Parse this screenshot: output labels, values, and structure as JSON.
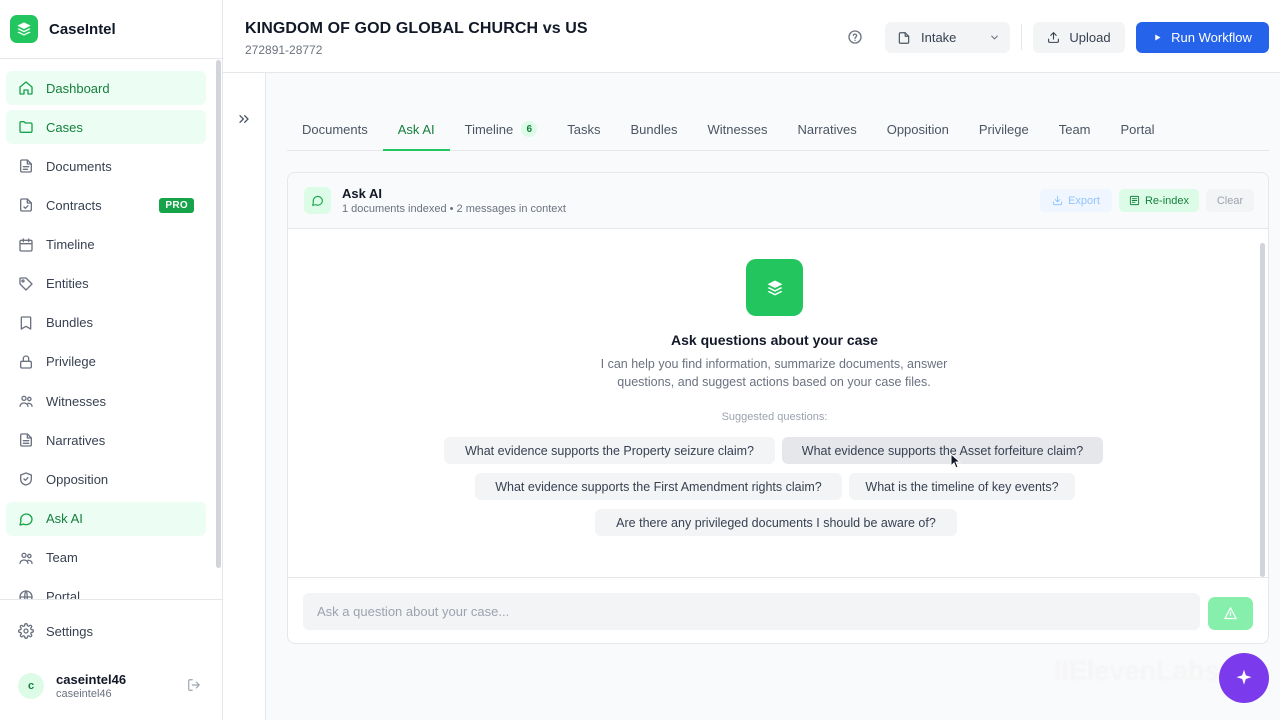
{
  "app": {
    "name": "CaseIntel"
  },
  "sidebar": {
    "items": [
      {
        "label": "Dashboard",
        "icon": "home-icon",
        "active": true
      },
      {
        "label": "Cases",
        "icon": "folder-icon",
        "active": true
      },
      {
        "label": "Documents",
        "icon": "document-icon",
        "active": false
      },
      {
        "label": "Contracts",
        "icon": "contract-icon",
        "active": false,
        "badge": "PRO"
      },
      {
        "label": "Timeline",
        "icon": "calendar-icon",
        "active": false
      },
      {
        "label": "Entities",
        "icon": "tag-icon",
        "active": false
      },
      {
        "label": "Bundles",
        "icon": "bundle-icon",
        "active": false
      },
      {
        "label": "Privilege",
        "icon": "lock-icon",
        "active": false
      },
      {
        "label": "Witnesses",
        "icon": "users-icon",
        "active": false
      },
      {
        "label": "Narratives",
        "icon": "narrative-icon",
        "active": false
      },
      {
        "label": "Opposition",
        "icon": "shield-icon",
        "active": false
      },
      {
        "label": "Ask AI",
        "icon": "chat-icon",
        "active": true
      },
      {
        "label": "Team",
        "icon": "team-icon",
        "active": false
      },
      {
        "label": "Portal",
        "icon": "globe-icon",
        "active": false
      }
    ],
    "settings_label": "Settings",
    "user": {
      "initial": "c",
      "name": "caseintel46",
      "handle": "caseintel46"
    }
  },
  "header": {
    "case_title": "KINGDOM OF GOD GLOBAL CHURCH vs US",
    "case_number": "272891-28772",
    "stage_value": "Intake",
    "upload_label": "Upload",
    "run_label": "Run Workflow"
  },
  "tabs": [
    {
      "label": "Documents"
    },
    {
      "label": "Ask AI",
      "active": true
    },
    {
      "label": "Timeline",
      "count": "6"
    },
    {
      "label": "Tasks"
    },
    {
      "label": "Bundles"
    },
    {
      "label": "Witnesses"
    },
    {
      "label": "Narratives"
    },
    {
      "label": "Opposition"
    },
    {
      "label": "Privilege"
    },
    {
      "label": "Team"
    },
    {
      "label": "Portal"
    }
  ],
  "panel": {
    "title": "Ask AI",
    "subtitle": "1 documents indexed • 2 messages in context",
    "export_label": "Export",
    "reindex_label": "Re-index",
    "clear_label": "Clear"
  },
  "chat": {
    "hero_title": "Ask questions about your case",
    "hero_desc": "I can help you find information, summarize documents, answer questions, and suggest actions based on your case files.",
    "suggested_label": "Suggested questions:",
    "suggestions": [
      "What evidence supports the Property seizure claim?",
      "What evidence supports the Asset forfeiture claim?",
      "What evidence supports the First Amendment rights claim?",
      "What is the timeline of key events?",
      "Are there any privileged documents I should be aware of?"
    ],
    "input_placeholder": "Ask a question about your case..."
  },
  "watermark": "IIElevenLabs",
  "colors": {
    "brand": "#22c55e",
    "primary": "#2563eb",
    "active_bg": "#ecfdf3",
    "fab": "#7c3aed"
  }
}
